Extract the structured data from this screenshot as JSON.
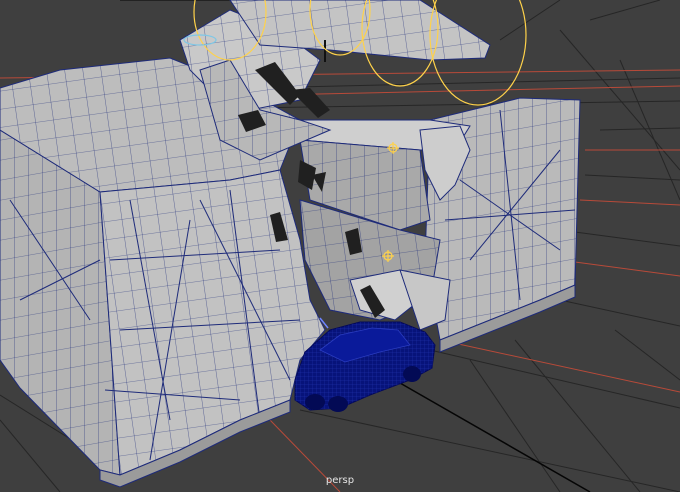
{
  "viewport": {
    "camera_label": "persp",
    "panel": "perspective-viewport"
  },
  "colors": {
    "background": "#3f3f3f",
    "grid": "#262626",
    "grid_axis_red": "#b84a39",
    "grid_axis_black": "#050505",
    "mesh_fill": "#b9b9b9",
    "mesh_dark": "#8c8c8c",
    "wireframe": "#1e2b7a",
    "car": "#07137a",
    "rotate_gizmo": "#ffd24a"
  },
  "icons": {
    "pivot_markers": "crosshair-pivot-icon",
    "rotate_manipulator": "rotate-gizmo-icon"
  }
}
